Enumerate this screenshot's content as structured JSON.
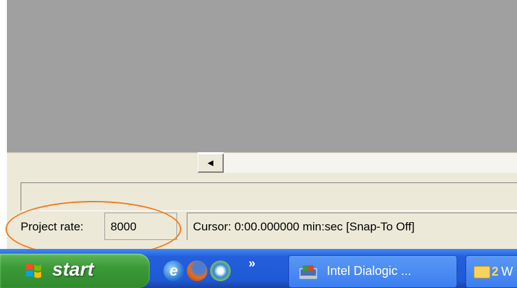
{
  "colors": {
    "track_background": "#a0a0a0",
    "panel": "#ece9d8",
    "highlight_oval": "#f07c1e",
    "taskbar": "#245edb",
    "start_button": "#3c9a38"
  },
  "scrollbar": {
    "left_arrow": "◀"
  },
  "status_bar": {
    "project_rate_label": "Project rate:",
    "project_rate_value": "8000",
    "cursor_text": "Cursor: 0:00.000000 min:sec  [Snap-To Off]"
  },
  "taskbar": {
    "start_label": "start",
    "quick_launch": [
      "internet-explorer-icon",
      "firefox-icon",
      "media-player-icon"
    ],
    "ie_glyph": "e",
    "overflow_chevron": "»",
    "tasks": [
      {
        "label": "Intel Dialogic ...",
        "icon": "dialogic-app-icon"
      },
      {
        "count": "2",
        "label": "W",
        "icon": "folder-icon"
      }
    ]
  }
}
